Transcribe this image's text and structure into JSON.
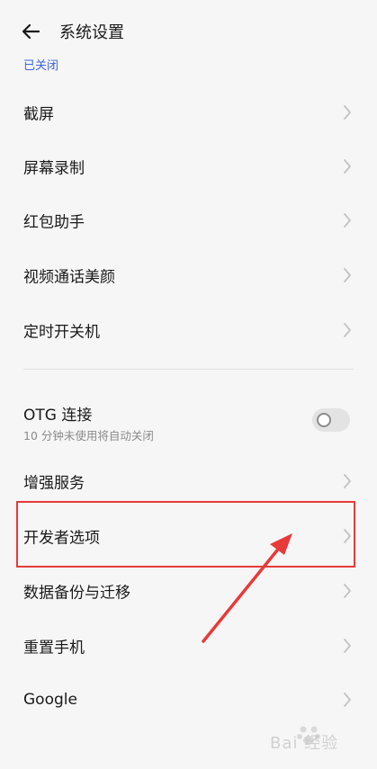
{
  "header": {
    "title": "系统设置",
    "back_icon": "back-arrow-icon"
  },
  "prev_item_status": "已关闭",
  "menu_group_1": [
    {
      "label": "截屏"
    },
    {
      "label": "屏幕录制"
    },
    {
      "label": "红包助手"
    },
    {
      "label": "视频通话美颜"
    },
    {
      "label": "定时开关机"
    }
  ],
  "otg": {
    "label": "OTG 连接",
    "sublabel": "10 分钟未使用将自动关闭",
    "enabled": false
  },
  "menu_group_2": [
    {
      "label": "增强服务"
    },
    {
      "label": "开发者选项"
    },
    {
      "label": "数据备份与迁移"
    },
    {
      "label": "重置手机"
    },
    {
      "label": "Google"
    }
  ],
  "colors": {
    "background": "#f6f6f6",
    "link": "#3f63d9",
    "highlight": "#e73a3a"
  },
  "watermark": {
    "text": "Bai 经验"
  }
}
